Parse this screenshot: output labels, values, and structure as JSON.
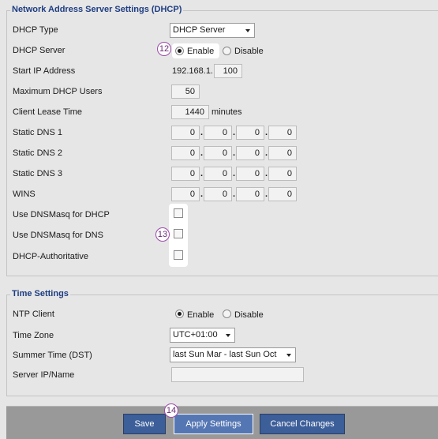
{
  "dhcp": {
    "legend": "Network Address Server Settings (DHCP)",
    "dhcp_type": {
      "label": "DHCP Type",
      "value": "DHCP Server"
    },
    "dhcp_server": {
      "label": "DHCP Server",
      "enable": "Enable",
      "disable": "Disable",
      "selected": "Enable"
    },
    "start_ip": {
      "label": "Start IP Address",
      "prefix": "192.168.1.",
      "last_octet": "100"
    },
    "max_users": {
      "label": "Maximum DHCP Users",
      "value": "50"
    },
    "lease": {
      "label": "Client Lease Time",
      "value": "1440",
      "unit": "minutes"
    },
    "static_dns_1": {
      "label": "Static DNS 1",
      "octets": [
        "0",
        "0",
        "0",
        "0"
      ]
    },
    "static_dns_2": {
      "label": "Static DNS 2",
      "octets": [
        "0",
        "0",
        "0",
        "0"
      ]
    },
    "static_dns_3": {
      "label": "Static DNS 3",
      "octets": [
        "0",
        "0",
        "0",
        "0"
      ]
    },
    "wins": {
      "label": "WINS",
      "octets": [
        "0",
        "0",
        "0",
        "0"
      ]
    },
    "dnsmasq_dhcp": {
      "label": "Use DNSMasq for DHCP",
      "checked": false
    },
    "dnsmasq_dns": {
      "label": "Use DNSMasq for DNS",
      "checked": false
    },
    "authoritative": {
      "label": "DHCP-Authoritative",
      "checked": false
    }
  },
  "time": {
    "legend": "Time Settings",
    "ntp_client": {
      "label": "NTP Client",
      "enable": "Enable",
      "disable": "Disable",
      "selected": "Enable"
    },
    "time_zone": {
      "label": "Time Zone",
      "value": "UTC+01:00"
    },
    "summer_time": {
      "label": "Summer Time (DST)",
      "value": "last Sun Mar - last Sun Oct"
    },
    "server": {
      "label": "Server IP/Name",
      "value": ""
    }
  },
  "buttons": {
    "save": "Save",
    "apply": "Apply Settings",
    "cancel": "Cancel Changes"
  },
  "badges": [
    "12",
    "13",
    "14"
  ]
}
